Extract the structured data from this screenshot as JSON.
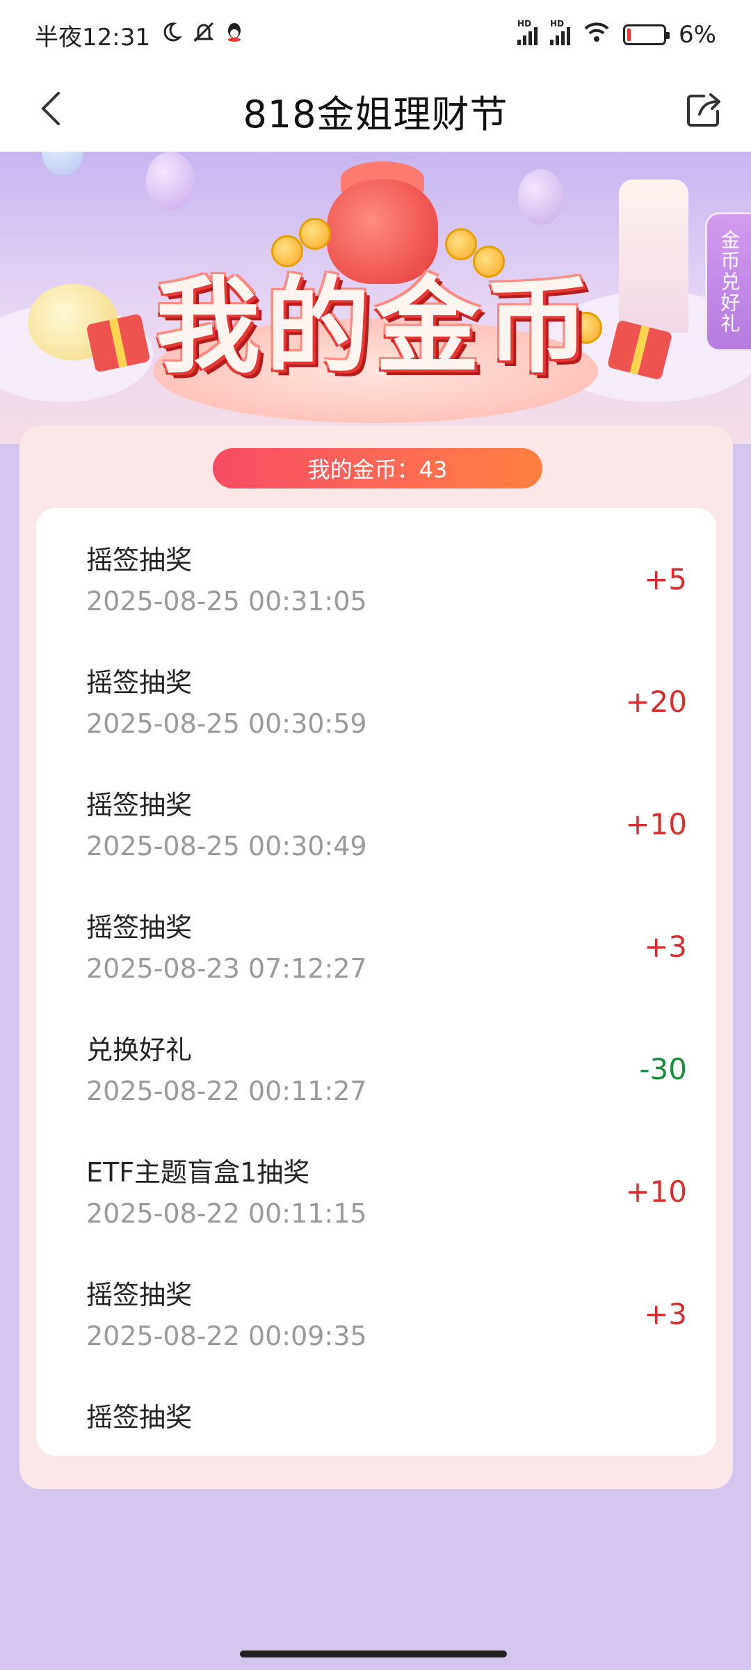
{
  "status_bar": {
    "time": "半夜12:31",
    "battery": "6%",
    "icons": [
      "moon-icon",
      "bell-off-icon",
      "qq-icon",
      "signal-hd-icon",
      "signal-hd-icon",
      "wifi-icon",
      "battery-icon"
    ],
    "hd_label": "HD"
  },
  "header": {
    "title": "818金姐理财节",
    "back_icon": "chevron-left-icon",
    "share_icon": "share-icon"
  },
  "banner": {
    "title": "我的金币",
    "side_tab": "金币兑好礼"
  },
  "summary": {
    "coins_text": "我的金币：43"
  },
  "records": [
    {
      "name": "摇签抽奖",
      "time": "2025-08-25 00:31:05",
      "amount": "+5",
      "type": "pos"
    },
    {
      "name": "摇签抽奖",
      "time": "2025-08-25 00:30:59",
      "amount": "+20",
      "type": "pos"
    },
    {
      "name": "摇签抽奖",
      "time": "2025-08-25 00:30:49",
      "amount": "+10",
      "type": "pos"
    },
    {
      "name": "摇签抽奖",
      "time": "2025-08-23 07:12:27",
      "amount": "+3",
      "type": "pos"
    },
    {
      "name": "兑换好礼",
      "time": "2025-08-22 00:11:27",
      "amount": "-30",
      "type": "neg"
    },
    {
      "name": "ETF主题盲盒1抽奖",
      "time": "2025-08-22 00:11:15",
      "amount": "+10",
      "type": "pos"
    },
    {
      "name": "摇签抽奖",
      "time": "2025-08-22 00:09:35",
      "amount": "+3",
      "type": "pos"
    },
    {
      "name": "摇签抽奖",
      "time": "",
      "amount": "",
      "type": "pos"
    }
  ],
  "colors": {
    "positive": "#d32f2f",
    "negative": "#1e8a3c",
    "page_bg": "#d3c5ee",
    "panel_bg": "#fce7e8"
  }
}
